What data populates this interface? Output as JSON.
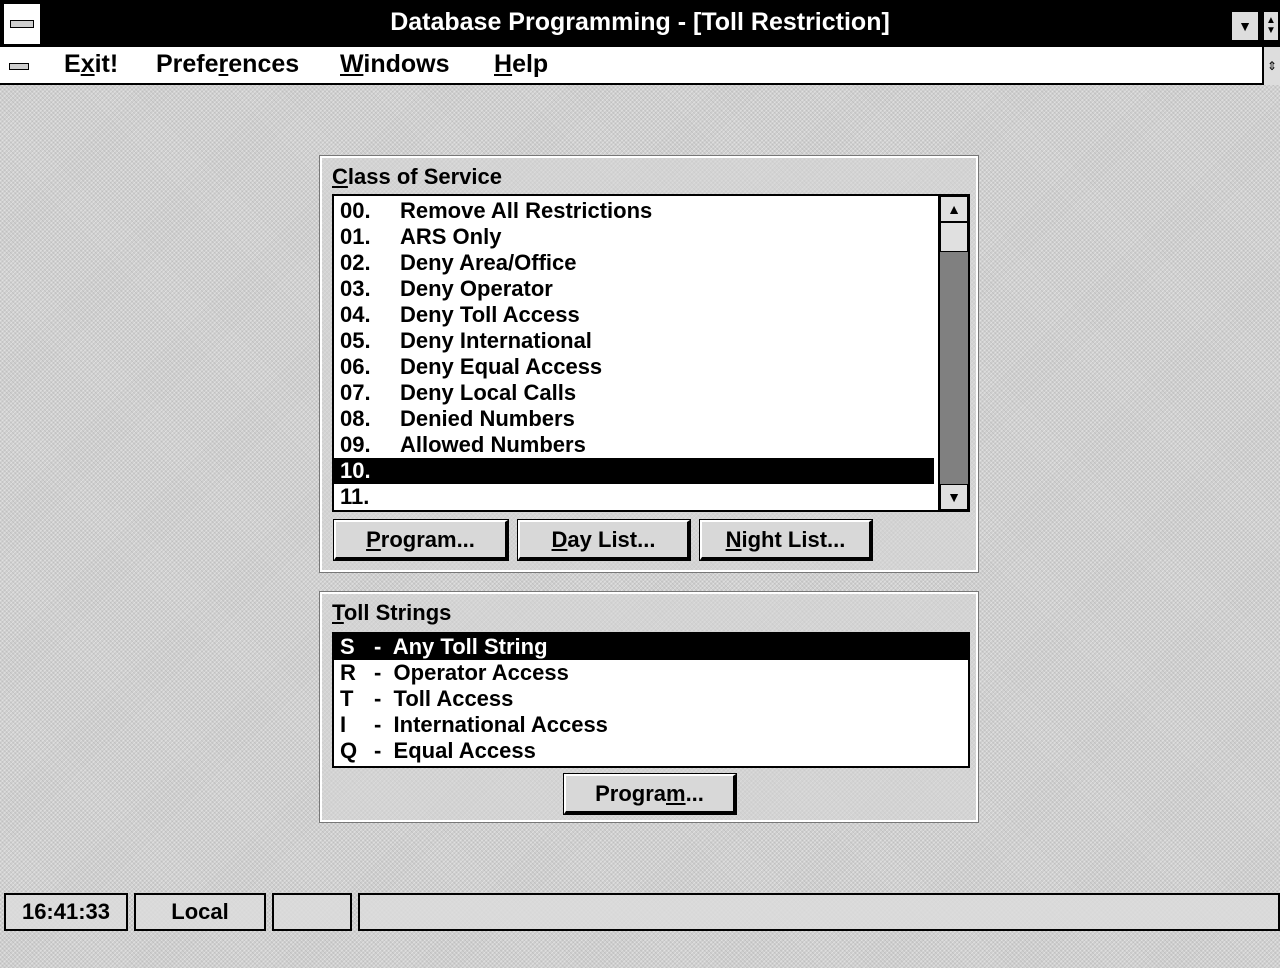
{
  "window": {
    "title": "Database Programming - [Toll Restriction]"
  },
  "menu": {
    "items": [
      {
        "pre": "E",
        "u": "x",
        "post": "it!"
      },
      {
        "pre": "Prefe",
        "u": "r",
        "post": "ences"
      },
      {
        "pre": "",
        "u": "W",
        "post": "indows"
      },
      {
        "pre": "",
        "u": "H",
        "post": "elp"
      }
    ]
  },
  "class_of_service": {
    "label_u": "C",
    "label_rest": "lass of Service",
    "items": [
      {
        "num": "00.",
        "text": "Remove All Restrictions"
      },
      {
        "num": "01.",
        "text": "ARS Only"
      },
      {
        "num": "02.",
        "text": "Deny Area/Office"
      },
      {
        "num": "03.",
        "text": "Deny Operator"
      },
      {
        "num": "04.",
        "text": "Deny Toll Access"
      },
      {
        "num": "05.",
        "text": "Deny International"
      },
      {
        "num": "06.",
        "text": "Deny Equal Access"
      },
      {
        "num": "07.",
        "text": "Deny Local Calls"
      },
      {
        "num": "08.",
        "text": "Denied Numbers"
      },
      {
        "num": "09.",
        "text": "Allowed Numbers"
      },
      {
        "num": "10.",
        "text": ""
      },
      {
        "num": "11.",
        "text": ""
      }
    ],
    "selected_index": 10,
    "buttons": {
      "program": {
        "u": "P",
        "rest": "rogram..."
      },
      "day_list": {
        "u": "D",
        "rest": "ay List..."
      },
      "night_list": {
        "u": "N",
        "rest": "ight List..."
      }
    }
  },
  "toll_strings": {
    "label_u": "T",
    "label_rest": "oll Strings",
    "items": [
      {
        "key": "S",
        "text": "-  Any Toll String"
      },
      {
        "key": "R",
        "text": "-  Operator Access"
      },
      {
        "key": "T",
        "text": "-  Toll Access"
      },
      {
        "key": "I",
        "text": "-  International Access"
      },
      {
        "key": "Q",
        "text": "-  Equal Access"
      }
    ],
    "selected_index": 0,
    "program_button": {
      "pre": "Progra",
      "u": "m",
      "post": "..."
    }
  },
  "statusbar": {
    "time": "16:41:33",
    "mode": "Local"
  },
  "icons": {
    "system_menu": "system-menu-icon",
    "minimize": "minimize-arrow-icon",
    "restore": "restore-arrows-icon",
    "scroll_up": "arrow-up-icon",
    "scroll_down": "arrow-down-icon"
  }
}
